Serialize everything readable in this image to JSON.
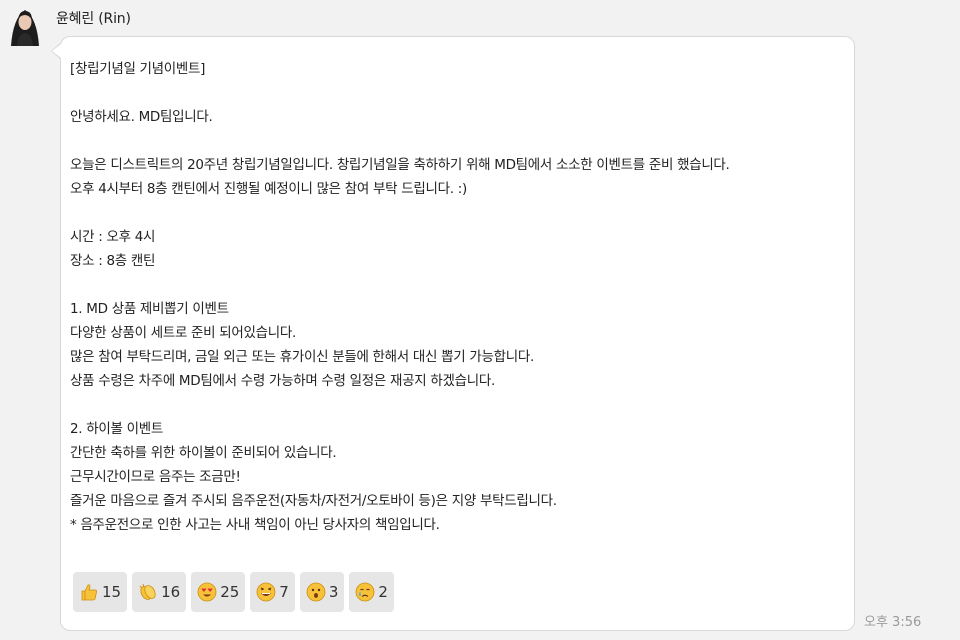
{
  "sender": {
    "name": "윤혜린 (Rin)"
  },
  "message": {
    "lines": [
      "[창립기념일 기념이벤트]",
      "",
      "안녕하세요. MD팀입니다.",
      "",
      "오늘은 디스트릭트의 20주년 창립기념일입니다. 창립기념일을 축하하기 위해 MD팀에서 소소한 이벤트를 준비 했습니다.",
      "오후 4시부터 8층 캔틴에서 진행될 예정이니 많은 참여 부탁 드립니다. :)",
      "",
      "시간 : 오후 4시",
      "장소 : 8층 캔틴",
      "",
      "1. MD 상품 제비뽑기 이벤트",
      "다양한 상품이 세트로 준비 되어있습니다.",
      "많은 참여 부탁드리며, 금일 외근 또는 휴가이신 분들에 한해서 대신 뽑기 가능합니다.",
      "상품 수령은 차주에 MD팀에서 수령 가능하며 수령 일정은 재공지 하겠습니다.",
      "",
      "2. 하이볼 이벤트",
      "간단한 축하를 위한 하이볼이 준비되어 있습니다.",
      "근무시간이므로 음주는 조금만!",
      "즐거운 마음으로 즐겨 주시되 음주운전(자동차/자전거/오토바이 등)은 지양 부탁드립니다.",
      "* 음주운전으로 인한 사고는 사내 책임이 아닌 당사자의 책임입니다."
    ]
  },
  "reactions": [
    {
      "icon": "thumbs-up-icon",
      "count": "15"
    },
    {
      "icon": "clapping-hands-icon",
      "count": "16"
    },
    {
      "icon": "heart-eyes-icon",
      "count": "25"
    },
    {
      "icon": "laughing-icon",
      "count": "7"
    },
    {
      "icon": "surprised-icon",
      "count": "3"
    },
    {
      "icon": "crying-icon",
      "count": "2"
    }
  ],
  "timestamp": "오후 3:56",
  "colors": {
    "background": "#f2f2f2",
    "bubble": "#ffffff",
    "reaction_bg": "#e6e6e6",
    "emoji_yellow": "#f7c23a"
  }
}
